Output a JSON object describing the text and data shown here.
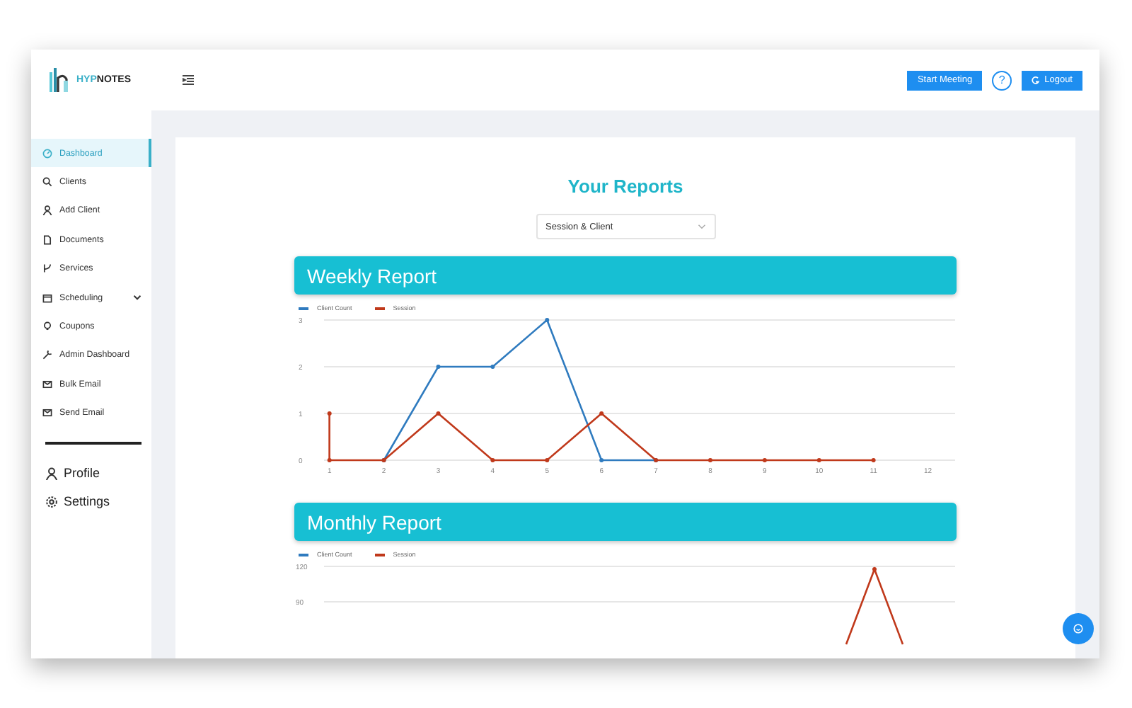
{
  "logo": {
    "part_1": "HYP",
    "part_2": "NOTES"
  },
  "header": {
    "start_button": "Start Meeting",
    "help_icon": "?",
    "logout_button": "Logout"
  },
  "sidebar": {
    "items": [
      {
        "label": "Dashboard",
        "selected": true
      },
      {
        "label": "Clients",
        "selected": false
      },
      {
        "label": "Add Client",
        "selected": false
      },
      {
        "label": "Documents",
        "selected": false
      },
      {
        "label": "Services",
        "selected": false
      },
      {
        "label": "Scheduling",
        "selected": false,
        "expandable": true
      },
      {
        "label": "Coupons",
        "selected": false
      },
      {
        "label": "Admin Dashboard",
        "selected": false
      },
      {
        "label": "Bulk Email",
        "selected": false
      },
      {
        "label": "Send Email",
        "selected": false
      }
    ],
    "bottom_items": [
      {
        "label": "Profile"
      },
      {
        "label": "Settings"
      }
    ]
  },
  "reports": {
    "title": "Your Reports",
    "filter": {
      "value": "Session & Client"
    },
    "weekly": {
      "title": "Weekly Report",
      "chart_data": {
        "type": "line",
        "x": [
          1,
          1,
          2,
          3,
          4,
          5,
          6,
          7,
          8,
          9,
          10,
          11
        ],
        "series": [
          {
            "name": "Client Count",
            "color": "#2f7bbf",
            "marker": true,
            "values": [
              null,
              null,
              0,
              2,
              2,
              3,
              0,
              0,
              null,
              null,
              null,
              null
            ]
          },
          {
            "name": "Session",
            "color": "#c0391b",
            "marker": true,
            "values": [
              1,
              0,
              0,
              1,
              0,
              0,
              1,
              0,
              0,
              0,
              0,
              0
            ]
          }
        ],
        "xticks": [
          1,
          2,
          3,
          4,
          5,
          6,
          7,
          8,
          9,
          10,
          11,
          12
        ],
        "yticks": [
          0,
          1,
          2,
          3
        ],
        "xlim": [
          0.9,
          12.5
        ],
        "ylim": [
          0,
          3
        ]
      }
    },
    "monthly": {
      "title": "Monthly Report",
      "legend": [
        {
          "name": "Client Count",
          "color": "#2f7bbf"
        },
        {
          "name": "Session",
          "color": "#c0391b"
        }
      ],
      "y_tick_labels": [
        "120",
        "90"
      ]
    }
  }
}
